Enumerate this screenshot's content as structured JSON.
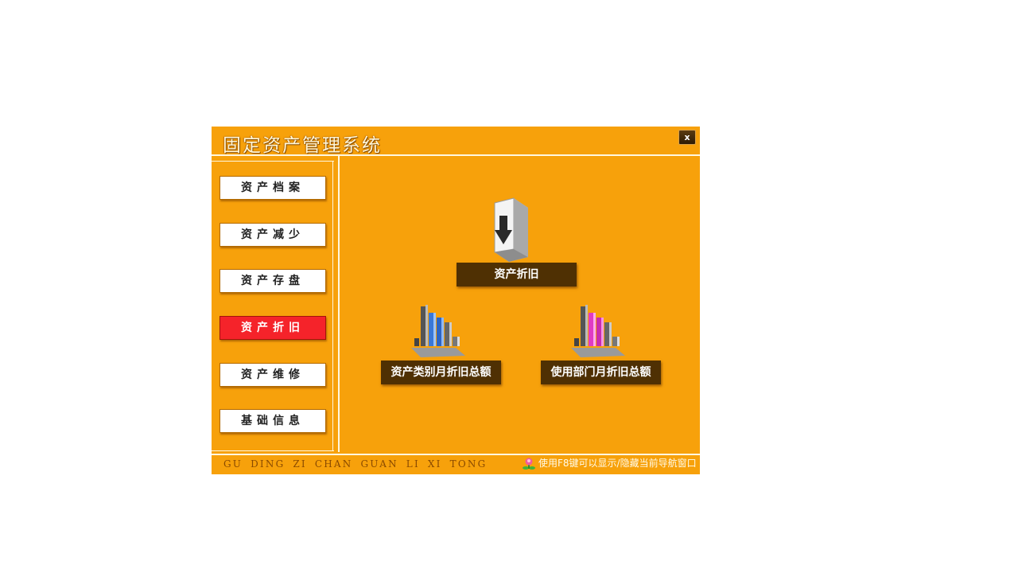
{
  "window": {
    "title": "固定资产管理系统",
    "close_label": "x"
  },
  "sidebar": {
    "items": [
      {
        "label": "资产档案",
        "active": false
      },
      {
        "label": "资产减少",
        "active": false
      },
      {
        "label": "资产存盘",
        "active": false
      },
      {
        "label": "资产折旧",
        "active": true
      },
      {
        "label": "资产维修",
        "active": false
      },
      {
        "label": "基础信息",
        "active": false
      }
    ]
  },
  "main": {
    "tiles": [
      {
        "label": "资产折旧",
        "icon": "download-folder-icon"
      },
      {
        "label": "资产类别月折旧总额",
        "icon": "blue-bar-chart-icon"
      },
      {
        "label": "使用部门月折旧总额",
        "icon": "pink-bar-chart-icon"
      }
    ]
  },
  "footer": {
    "pinyin": "GU DING ZI CHAN GUAN LI XI TONG",
    "hint": "使用F8键可以显示/隐藏当前导航窗口",
    "hint_icon": "flower-icon"
  },
  "colors": {
    "background": "#f7a10b",
    "tile_label": "#4f3003",
    "active_nav": "#f5232a"
  }
}
